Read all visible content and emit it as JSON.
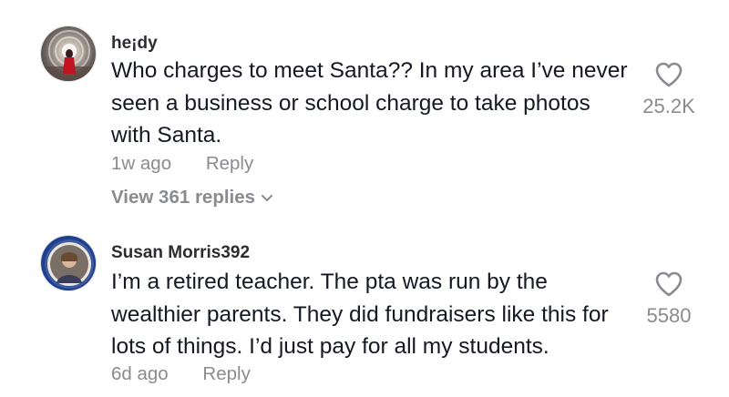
{
  "comments": [
    {
      "username": "he¡dy",
      "text": "Who charges to meet Santa?? In my area I’ve never seen a business or school charge to take photos with Santa.",
      "age": "1w ago",
      "reply_label": "Reply",
      "view_replies": "View 361 replies",
      "likes": "25.2K",
      "avatar_icon": "profile-photo-red-figure-in-tunnel"
    },
    {
      "username": "Susan Morris392",
      "text": "I’m a retired teacher. The pta was run by the wealthier parents. They did fundraisers like this for lots of things. I’d just pay for all my students.",
      "age": "6d ago",
      "reply_label": "Reply",
      "likes": "5580",
      "avatar_icon": "profile-photo-circular-badge"
    }
  ],
  "colors": {
    "text": "#161823",
    "secondary": "#8a8b91",
    "background": "#ffffff"
  }
}
